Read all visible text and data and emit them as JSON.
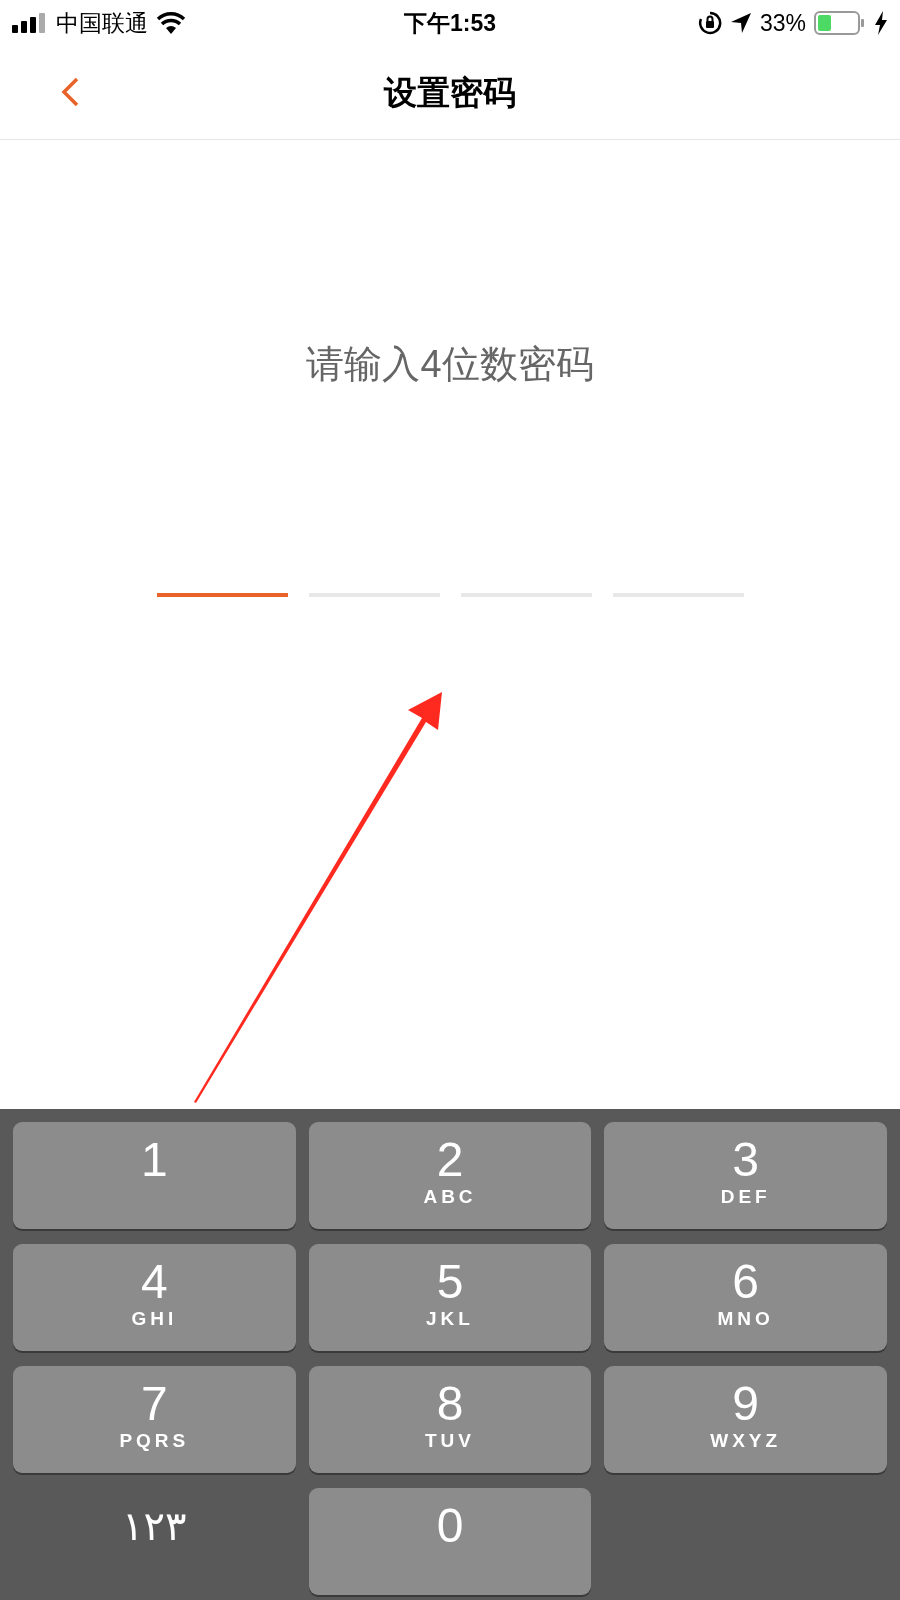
{
  "status_bar": {
    "carrier": "中国联通",
    "time": "下午1:53",
    "battery": "33%"
  },
  "nav": {
    "title": "设置密码"
  },
  "prompt": "请输入4位数密码",
  "pin_slots": [
    {
      "selected": true
    },
    {
      "selected": false
    },
    {
      "selected": false
    },
    {
      "selected": false
    }
  ],
  "keypad": [
    {
      "kind": "digit",
      "digit": "1"
    },
    {
      "kind": "digit",
      "digit": "2",
      "letters": "ABC"
    },
    {
      "kind": "digit",
      "digit": "3",
      "letters": "DEF"
    },
    {
      "kind": "digit",
      "digit": "4",
      "letters": "GHI"
    },
    {
      "kind": "digit",
      "digit": "5",
      "letters": "JKL"
    },
    {
      "kind": "digit",
      "digit": "6",
      "letters": "MNO"
    },
    {
      "kind": "digit",
      "digit": "7",
      "letters": "PQRS"
    },
    {
      "kind": "digit",
      "digit": "8",
      "letters": "TUV"
    },
    {
      "kind": "digit",
      "digit": "9",
      "letters": "WXYZ"
    },
    {
      "kind": "mode",
      "label": "١٢٣"
    },
    {
      "kind": "digit",
      "digit": "0"
    }
  ]
}
